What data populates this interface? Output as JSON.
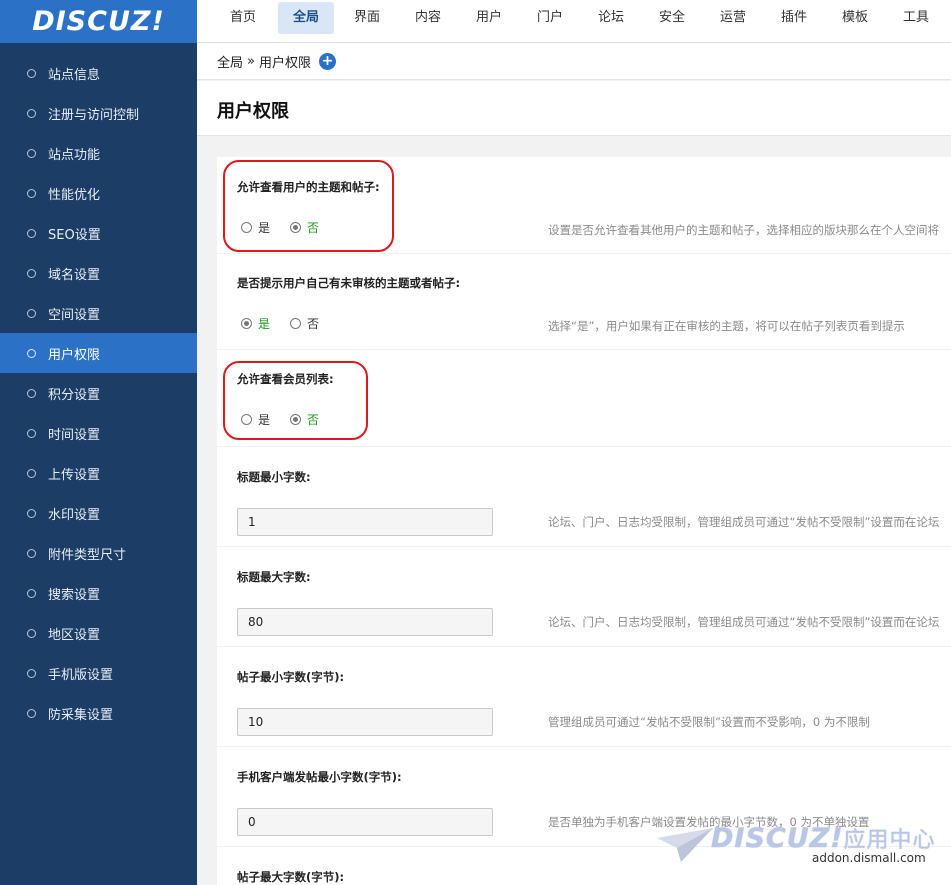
{
  "logo": "DISCUZ!",
  "topnav": {
    "tabs": [
      {
        "label": "首页"
      },
      {
        "label": "全局"
      },
      {
        "label": "界面"
      },
      {
        "label": "内容"
      },
      {
        "label": "用户"
      },
      {
        "label": "门户"
      },
      {
        "label": "论坛"
      },
      {
        "label": "安全"
      },
      {
        "label": "运营"
      },
      {
        "label": "插件"
      },
      {
        "label": "模板"
      },
      {
        "label": "工具"
      }
    ],
    "active_index": 1
  },
  "sidebar": {
    "items": [
      {
        "label": "站点信息"
      },
      {
        "label": "注册与访问控制"
      },
      {
        "label": "站点功能"
      },
      {
        "label": "性能优化"
      },
      {
        "label": "SEO设置"
      },
      {
        "label": "域名设置"
      },
      {
        "label": "空间设置"
      },
      {
        "label": "用户权限"
      },
      {
        "label": "积分设置"
      },
      {
        "label": "时间设置"
      },
      {
        "label": "上传设置"
      },
      {
        "label": "水印设置"
      },
      {
        "label": "附件类型尺寸"
      },
      {
        "label": "搜索设置"
      },
      {
        "label": "地区设置"
      },
      {
        "label": "手机版设置"
      },
      {
        "label": "防采集设置"
      }
    ],
    "active_index": 7
  },
  "breadcrumb": {
    "root": "全局",
    "separator": "»",
    "current": "用户权限"
  },
  "page_title": "用户权限",
  "form": {
    "options": {
      "yes": "是",
      "no": "否"
    },
    "rows": [
      {
        "label": "允许查看用户的主题和帖子:",
        "type": "radio",
        "value": "否",
        "hint": "设置是否允许查看其他用户的主题和帖子，选择相应的版块那么在个人空间将"
      },
      {
        "label": "是否提示用户自己有未审核的主题或者帖子:",
        "type": "radio",
        "value": "是",
        "hint": "选择“是”，用户如果有正在审核的主题，将可以在帖子列表页看到提示"
      },
      {
        "label": "允许查看会员列表:",
        "type": "radio",
        "value": "否",
        "hint": ""
      },
      {
        "label": "标题最小字数:",
        "type": "text",
        "value": "1",
        "hint": "论坛、门户、日志均受限制，管理组成员可通过“发帖不受限制”设置而在论坛"
      },
      {
        "label": "标题最大字数:",
        "type": "text",
        "value": "80",
        "hint": "论坛、门户、日志均受限制，管理组成员可通过“发帖不受限制”设置而在论坛"
      },
      {
        "label": "帖子最小字数(字节):",
        "type": "text",
        "value": "10",
        "hint": "管理组成员可通过“发帖不受限制”设置而不受影响，0 为不限制"
      },
      {
        "label": "手机客户端发帖最小字数(字节):",
        "type": "text",
        "value": "0",
        "hint": "是否单独为手机客户端设置发帖的最小字节数，0 为不单独设置"
      },
      {
        "label": "帖子最大字数(字节):",
        "type": "text",
        "value": "",
        "hint": ""
      }
    ]
  },
  "highlight_color": "#e0171b",
  "watermark": {
    "brand": "DISCUZ!",
    "brand_cn": "应用中心",
    "url": "addon.dismall.com"
  }
}
